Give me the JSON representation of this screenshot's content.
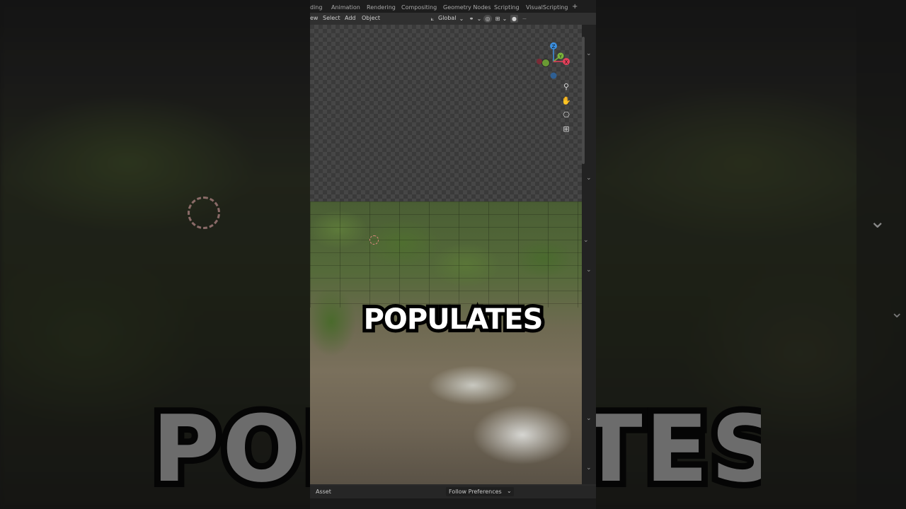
{
  "background": {
    "big_caption": "POPULATES"
  },
  "workspace_tabs": [
    "ding",
    "Animation",
    "Rendering",
    "Compositing",
    "Geometry Nodes",
    "Scripting",
    "VisualScripting"
  ],
  "add_tab_symbol": "+",
  "header": {
    "menus": [
      "ew",
      "Select",
      "Add",
      "Object"
    ],
    "orientation": "Global"
  },
  "gizmo": {
    "axes": [
      "Z",
      "Y",
      "X"
    ],
    "colors": {
      "x": "#e5405a",
      "y": "#7bb53a",
      "z": "#3b8fe0"
    }
  },
  "nav_icons": [
    "zoom-icon",
    "pan-hand-icon",
    "camera-icon",
    "grid-view-icon"
  ],
  "footer": {
    "left_label": "Asset",
    "dropdown_value": "Follow Preferences"
  },
  "caption": "POPULATES"
}
